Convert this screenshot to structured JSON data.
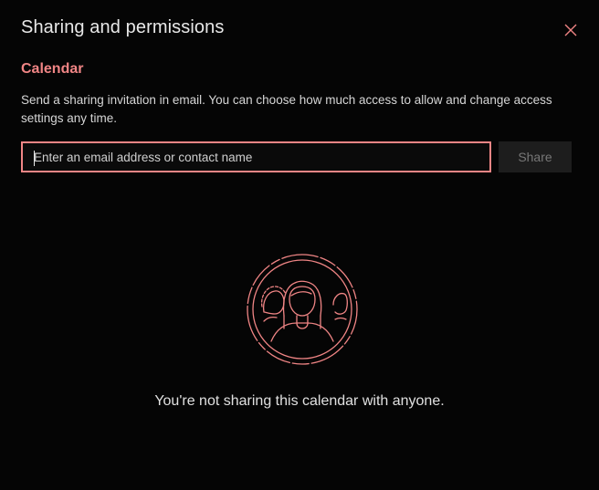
{
  "dialog": {
    "title": "Sharing and permissions",
    "close_icon": "close-icon"
  },
  "calendar": {
    "name": "Calendar",
    "description": "Send a sharing invitation in email. You can choose how much access to allow and change access settings any time."
  },
  "invite": {
    "placeholder": "Enter an email address or contact name",
    "value": "",
    "share_label": "Share",
    "share_enabled": false
  },
  "empty_state": {
    "illustration_icon": "people-group-icon",
    "message": "You're not sharing this calendar with anyone."
  },
  "colors": {
    "accent": "#f08585",
    "background": "#050505",
    "button_bg": "#1d1d1d",
    "button_text_disabled": "#777777"
  }
}
